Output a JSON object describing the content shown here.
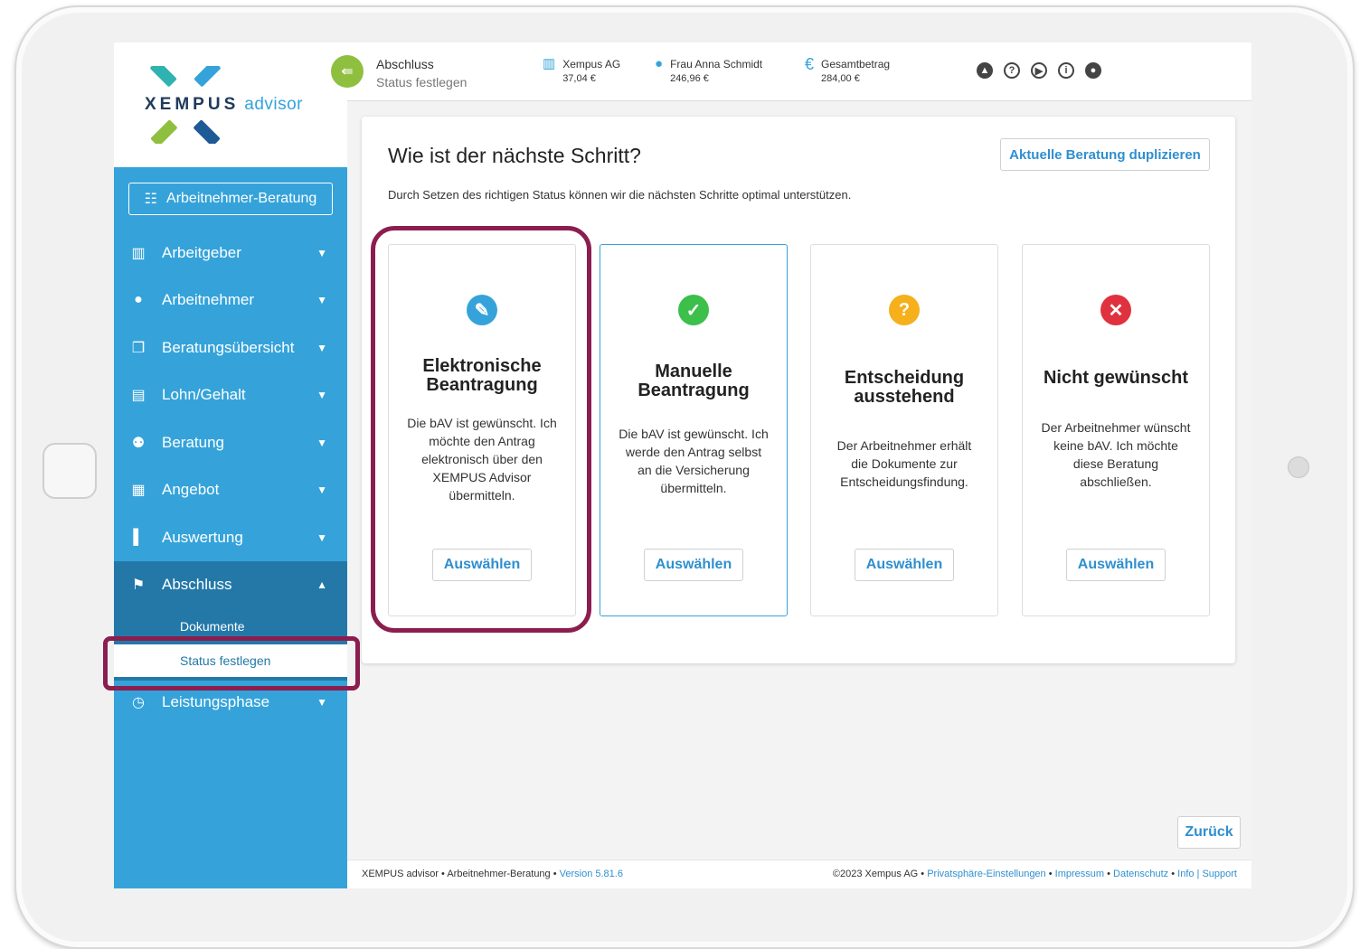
{
  "brand": {
    "logo_word": "XEMPUS",
    "logo_suffix": "advisor"
  },
  "sidebar": {
    "consult_button": "Arbeitnehmer-Beratung",
    "items": [
      {
        "label": "Arbeitgeber",
        "icon": "factory-icon"
      },
      {
        "label": "Arbeitnehmer",
        "icon": "person-icon"
      },
      {
        "label": "Beratungsübersicht",
        "icon": "copy-icon"
      },
      {
        "label": "Lohn/Gehalt",
        "icon": "document-icon"
      },
      {
        "label": "Beratung",
        "icon": "group-icon"
      },
      {
        "label": "Angebot",
        "icon": "calculator-icon"
      },
      {
        "label": "Auswertung",
        "icon": "bar-chart-icon"
      },
      {
        "label": "Abschluss",
        "icon": "flag-icon"
      },
      {
        "label": "Leistungsphase",
        "icon": "history-icon"
      }
    ],
    "sub_items": [
      "Dokumente",
      "Status festlegen"
    ]
  },
  "topbar": {
    "crumb_main": "Abschluss",
    "crumb_sub": "Status festlegen",
    "employer": {
      "label": "Xempus AG",
      "value": "37,04 €"
    },
    "employee": {
      "label": "Frau Anna Schmidt",
      "value": "246,96 €"
    },
    "total": {
      "label": "Gesamtbetrag",
      "value": "284,00 €"
    }
  },
  "card": {
    "title": "Wie ist der nächste Schritt?",
    "duplicate_button": "Aktuelle Beratung duplizieren",
    "description": "Durch Setzen des richtigen Status können wir die nächsten Schritte optimal unterstützen.",
    "options": [
      {
        "title_1": "Elektronische",
        "title_2": "Beantragung",
        "text_1": "Die bAV ist gewünscht. Ich",
        "text_2": "möchte den Antrag",
        "text_3": "elektronisch über den",
        "text_4": "XEMPUS Advisor",
        "text_5": "übermitteln.",
        "button": "Auswählen",
        "color": "#35a3da"
      },
      {
        "title_1": "Manuelle",
        "title_2": "Beantragung",
        "text_1": "Die bAV ist gewünscht. Ich",
        "text_2": "werde den Antrag selbst",
        "text_3": "an die Versicherung",
        "text_4": "übermitteln.",
        "button": "Auswählen",
        "color": "#3cbf4b"
      },
      {
        "title_1": "Entscheidung",
        "title_2": "ausstehend",
        "text_1": "Der Arbeitnehmer erhält",
        "text_2": "die Dokumente zur",
        "text_3": "Entscheidungsfindung.",
        "button": "Auswählen",
        "color": "#f5b01c"
      },
      {
        "title_1": "Nicht gewünscht",
        "text_1": "Der Arbeitnehmer wünscht",
        "text_2": "keine bAV. Ich möchte",
        "text_3": "diese Beratung",
        "text_4": "abschließen.",
        "button": "Auswählen",
        "color": "#e0323e"
      }
    ]
  },
  "back_button": "Zurück",
  "footer": {
    "left_text": "XEMPUS advisor • Arbeitnehmer-Beratung • ",
    "version": "Version 5.81.6",
    "copyright": "©2023 Xempus AG • ",
    "privacy_settings": "Privatsphäre-Einstellungen",
    "sep": " • ",
    "imprint": "Impressum",
    "data_protection": "Datenschutz",
    "info_support": "Info | Support"
  },
  "highlight_color": "#8b1e4f"
}
